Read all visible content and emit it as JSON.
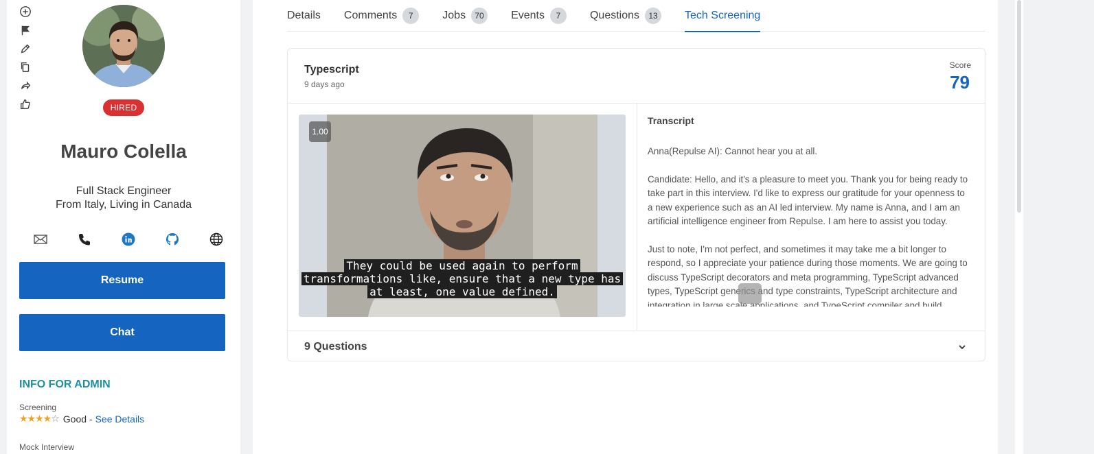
{
  "left_panel": {
    "action_icons": [
      "add-icon",
      "flag-icon",
      "edit-icon",
      "copy-icon",
      "share-icon",
      "thumbs-up-icon"
    ],
    "badge": "HIRED",
    "name": "Mauro Colella",
    "role": "Full Stack Engineer",
    "location": "From Italy, Living in Canada",
    "contacts": [
      "mail-icon",
      "phone-icon",
      "linkedin-icon",
      "github-icon",
      "globe-icon"
    ],
    "resume_button": "Resume",
    "chat_button": "Chat",
    "admin_title": "INFO FOR ADMIN",
    "screening_label": "Screening",
    "screening_stars": 4,
    "screening_rating": "Good -",
    "see_details": "See Details",
    "mock_interview_label": "Mock Interview"
  },
  "tabs": [
    {
      "label": "Details",
      "count": null
    },
    {
      "label": "Comments",
      "count": "7"
    },
    {
      "label": "Jobs",
      "count": "70"
    },
    {
      "label": "Events",
      "count": "7"
    },
    {
      "label": "Questions",
      "count": "13"
    },
    {
      "label": "Tech Screening",
      "count": null,
      "active": true
    }
  ],
  "screening": {
    "title": "Typescript",
    "time_ago": "9 days ago",
    "score_label": "Score",
    "score": "79",
    "video": {
      "speed": "1.00",
      "subtitle": "They could be used again to perform transformations like, ensure that a new type has at least, one value defined."
    },
    "transcript_title": "Transcript",
    "transcript": [
      "Anna(Repulse AI): Cannot hear you at all.",
      "Candidate: Hello, and it's a pleasure to meet you. Thank you for being ready to take part in this interview. I'd like to express our gratitude for your openness to a new experience such as an AI led interview. My name is Anna, and I am an artificial intelligence engineer from Repulse. I am here to assist you today.",
      "Just to note, I'm not perfect, and sometimes it may take me a bit longer to respond, so I appreciate your patience during those moments. We are going to discuss TypeScript decorators and meta programming, TypeScript advanced types, TypeScript generics and type constraints, TypeScript architecture and integration in large scale applications, and TypeScript compiler and build"
    ],
    "questions_label": "9 Questions"
  },
  "colors": {
    "accent": "#1565c0",
    "badge": "#d93131",
    "admin_title": "#1f8fa0",
    "stars": "#f0a020"
  }
}
